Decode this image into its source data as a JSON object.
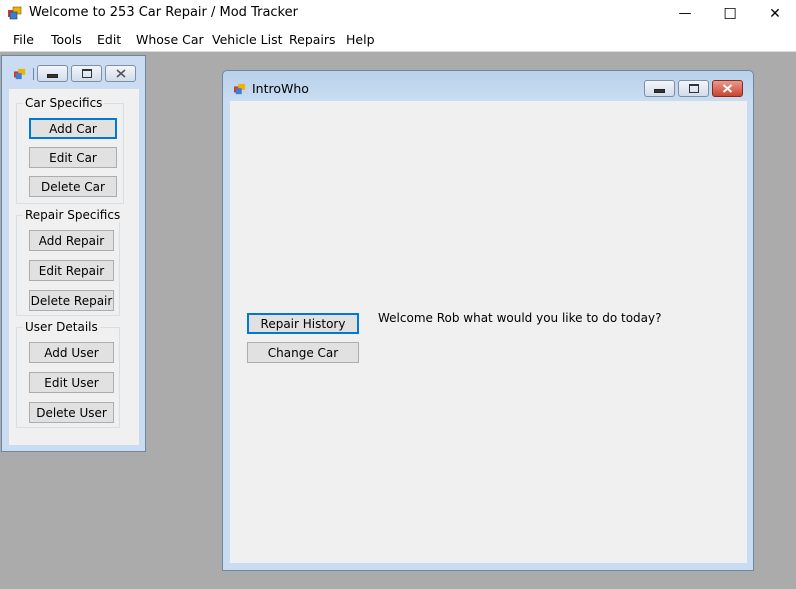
{
  "app": {
    "title": "Welcome to 253 Car Repair / Mod Tracker",
    "caption_buttons": {
      "minimize": "—",
      "maximize": "☐",
      "close": "✕"
    }
  },
  "menu": {
    "items": [
      "File",
      "Tools",
      "Edit",
      "Whose Car",
      "Vehicle List",
      "Repairs",
      "Help"
    ]
  },
  "toolbox": {
    "groups": [
      {
        "label": "Car Specifics",
        "buttons": [
          "Add Car",
          "Edit Car",
          "Delete Car"
        ]
      },
      {
        "label": "Repair Specifics",
        "buttons": [
          "Add Repair",
          "Edit Repair",
          "Delete Repair"
        ]
      },
      {
        "label": "User Details",
        "buttons": [
          "Add User",
          "Edit User",
          "Delete User"
        ]
      }
    ]
  },
  "child": {
    "title": "IntroWho",
    "welcome_text": "Welcome Rob what would you like to do today?",
    "buttons": {
      "repair_history": "Repair History",
      "change_car": "Change Car"
    }
  },
  "colors": {
    "accent": "#0078d7",
    "mdi_background": "#ababab",
    "form_background": "#f0f0f0",
    "close_red": "#c9452f"
  }
}
